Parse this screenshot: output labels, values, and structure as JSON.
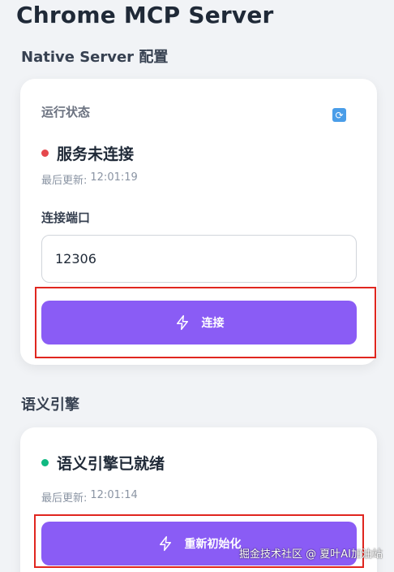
{
  "app": {
    "title": "Chrome MCP Server"
  },
  "native_server": {
    "section_title": "Native Server 配置",
    "status_label": "运行状态",
    "refresh_icon": "refresh-icon",
    "status_text": "服务未连接",
    "status_color": "#e5484d",
    "last_updated_label": "最后更新:",
    "last_updated_time": "12:01:19",
    "port_label": "连接端口",
    "port_value": "12306",
    "connect_label": "连接"
  },
  "semantic_engine": {
    "section_title": "语义引擎",
    "status_text": "语义引擎已就绪",
    "status_color": "#10b981",
    "last_updated_label": "最后更新:",
    "last_updated_time": "12:01:14",
    "reinit_label": "重新初始化"
  },
  "colors": {
    "accent": "#8a5cf5",
    "highlight": "#e0261f"
  },
  "watermark": "掘金技术社区 @ 夏叶AI加油站"
}
